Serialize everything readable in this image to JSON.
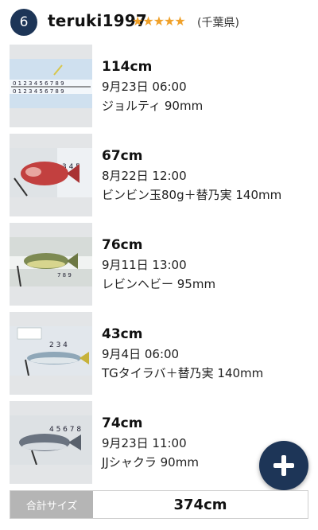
{
  "header": {
    "rank": "6",
    "username": "teruki1997",
    "stars": "★★★★★",
    "prefecture": "(千葉県)"
  },
  "catches": [
    {
      "size": "114cm",
      "date": "9月23日 06:00",
      "tackle": "ジョルティ 90mm"
    },
    {
      "size": "67cm",
      "date": "8月22日 12:00",
      "tackle": "ビンビン玉80g＋替乃実 140mm"
    },
    {
      "size": "76cm",
      "date": "9月11日 13:00",
      "tackle": "レビンヘビー 95mm"
    },
    {
      "size": "43cm",
      "date": "9月4日 06:00",
      "tackle": "TGタイラバ＋替乃実 140mm"
    },
    {
      "size": "74cm",
      "date": "9月23日 11:00",
      "tackle": "JJシャクラ 90mm"
    }
  ],
  "total": {
    "label": "合計サイズ",
    "value": "374cm"
  },
  "fab": {
    "icon": "plus-icon"
  },
  "colors": {
    "accent": "#1d3557",
    "stars": "#f0a12a",
    "total_label_bg": "#b5b5b5"
  }
}
